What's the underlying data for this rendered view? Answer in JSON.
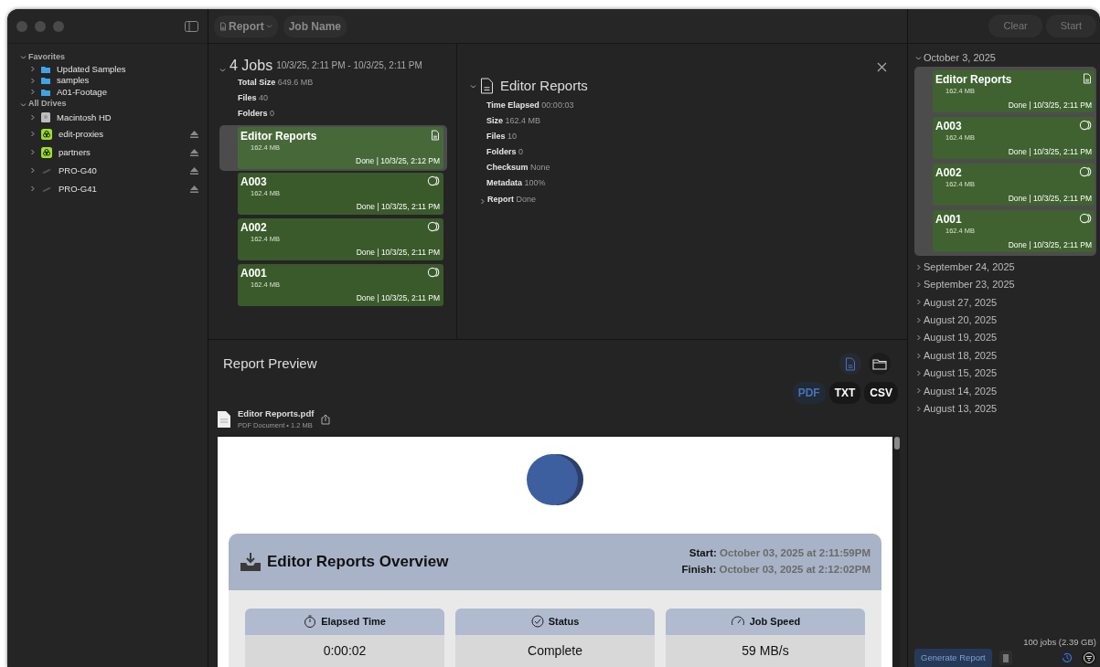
{
  "window": {
    "toolbar": {
      "report_menu": "Report",
      "job_name": "Job Name",
      "buttons": [
        {
          "label": "Clear",
          "disabled": true
        },
        {
          "label": "Start",
          "disabled": true
        }
      ]
    }
  },
  "sidebar": {
    "sections": [
      {
        "title": "Favorites",
        "expanded": true,
        "items": [
          {
            "label": "Updated Samples",
            "kind": "folder",
            "ejectable": false
          },
          {
            "label": "samples",
            "kind": "folder",
            "ejectable": false
          },
          {
            "label": "A01-Footage",
            "kind": "folder",
            "ejectable": false
          }
        ]
      },
      {
        "title": "All Drives",
        "expanded": true,
        "items": [
          {
            "label": "Macintosh HD",
            "kind": "disk",
            "ejectable": false
          },
          {
            "label": "edit-proxies",
            "kind": "server",
            "ejectable": true
          },
          {
            "label": "partners",
            "kind": "server",
            "ejectable": true
          },
          {
            "label": "PRO-G40",
            "kind": "drive",
            "ejectable": true
          },
          {
            "label": "PRO-G41",
            "kind": "drive",
            "ejectable": true
          }
        ]
      }
    ]
  },
  "jobs": {
    "title": "4 Jobs",
    "range": "10/3/25, 2:11 PM - 10/3/25, 2:11 PM",
    "expanded": true,
    "stats": [
      {
        "label": "Total Size",
        "value": "649.6 MB"
      },
      {
        "label": "Files",
        "value": "40"
      },
      {
        "label": "Folders",
        "value": "0"
      }
    ],
    "items": [
      {
        "name": "Editor Reports",
        "size": "162.4 MB",
        "status": "Done | 10/3/25, 2:12 PM",
        "kind": "report",
        "selected": true
      },
      {
        "name": "A003",
        "size": "162.4 MB",
        "status": "Done | 10/3/25, 2:11 PM",
        "kind": "copy",
        "selected": false
      },
      {
        "name": "A002",
        "size": "162.4 MB",
        "status": "Done | 10/3/25, 2:11 PM",
        "kind": "copy",
        "selected": false
      },
      {
        "name": "A001",
        "size": "162.4 MB",
        "status": "Done | 10/3/25, 2:11 PM",
        "kind": "copy",
        "selected": false
      }
    ]
  },
  "details": {
    "title": "Editor Reports",
    "expanded": true,
    "rows": [
      {
        "label": "Time Elapsed",
        "value": "00:00:03"
      },
      {
        "label": "Size",
        "value": "162.4 MB"
      },
      {
        "label": "Files",
        "value": "10"
      },
      {
        "label": "Folders",
        "value": "0"
      },
      {
        "label": "Checksum",
        "value": "None"
      },
      {
        "label": "Metadata",
        "value": "100%"
      }
    ],
    "report": {
      "label": "Report",
      "value": "Done",
      "expanded": false
    }
  },
  "preview": {
    "title": "Report Preview",
    "views": [
      {
        "kind": "document",
        "selected": true
      },
      {
        "kind": "folder",
        "selected": false
      }
    ],
    "formats": [
      {
        "label": "PDF",
        "selected": true
      },
      {
        "label": "TXT",
        "selected": false
      },
      {
        "label": "CSV",
        "selected": false
      }
    ],
    "file": {
      "name": "Editor Reports.pdf",
      "info": "PDF Document • 1.2 MB"
    },
    "pdf": {
      "title": "Editor Reports Overview",
      "start_label": "Start:",
      "start_value": "October 03, 2025 at 2:11:59PM",
      "finish_label": "Finish:",
      "finish_value": "October 03, 2025 at 2:12:02PM",
      "metrics": [
        {
          "label": "Elapsed Time",
          "value": "0:00:02",
          "kind": "timer"
        },
        {
          "label": "Status",
          "value": "Complete",
          "kind": "check"
        },
        {
          "label": "Job Speed",
          "value": "59 MB/s",
          "kind": "gauge"
        }
      ]
    }
  },
  "history": {
    "groups": [
      {
        "date": "October 3, 2025",
        "expanded": true,
        "items": [
          {
            "name": "Editor Reports",
            "size": "162.4 MB",
            "status": "Done | 10/3/25, 2:11 PM",
            "kind": "report"
          },
          {
            "name": "A003",
            "size": "162.4 MB",
            "status": "Done | 10/3/25, 2:11 PM",
            "kind": "copy"
          },
          {
            "name": "A002",
            "size": "162.4 MB",
            "status": "Done | 10/3/25, 2:11 PM",
            "kind": "copy"
          },
          {
            "name": "A001",
            "size": "162.4 MB",
            "status": "Done | 10/3/25, 2:11 PM",
            "kind": "copy"
          }
        ]
      },
      {
        "date": "September 24, 2025",
        "expanded": false
      },
      {
        "date": "September 23, 2025",
        "expanded": false
      },
      {
        "date": "August 27, 2025",
        "expanded": false
      },
      {
        "date": "August 20, 2025",
        "expanded": false
      },
      {
        "date": "August 19, 2025",
        "expanded": false
      },
      {
        "date": "August 18, 2025",
        "expanded": false
      },
      {
        "date": "August 15, 2025",
        "expanded": false
      },
      {
        "date": "August 14, 2025",
        "expanded": false
      },
      {
        "date": "August 13, 2025",
        "expanded": false
      }
    ],
    "summary": "100 jobs (2.39 GB)",
    "generate_button": "Generate Report"
  }
}
